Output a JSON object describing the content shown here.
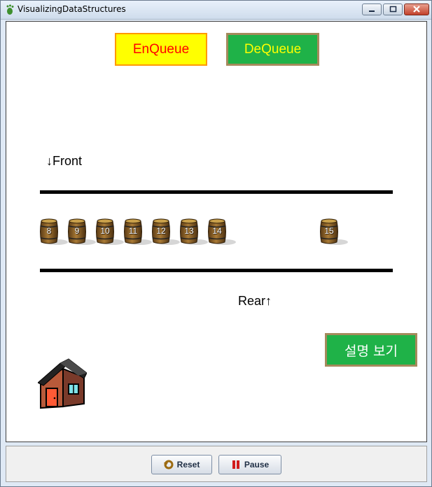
{
  "window": {
    "title": "VisualizingDataStructures"
  },
  "canvas": {
    "enqueue_label": "EnQueue",
    "dequeue_label": "DeQueue",
    "front_label": "↓Front",
    "rear_label": "Rear↑",
    "describe_label": "설명 보기",
    "queue_items": [
      "8",
      "9",
      "10",
      "11",
      "12",
      "13",
      "14",
      "15"
    ]
  },
  "controls": {
    "reset_label": "Reset",
    "pause_label": "Pause"
  },
  "colors": {
    "enqueue_bg": "#ffff00",
    "enqueue_text": "#ff0000",
    "dequeue_bg": "#1fb248",
    "dequeue_text": "#ffff00",
    "describe_bg": "#1fb248"
  },
  "icons": {
    "app": "footprint-icon",
    "reset": "reset-icon",
    "pause": "pause-icon",
    "item": "barrel-icon",
    "decoration": "house-icon"
  }
}
